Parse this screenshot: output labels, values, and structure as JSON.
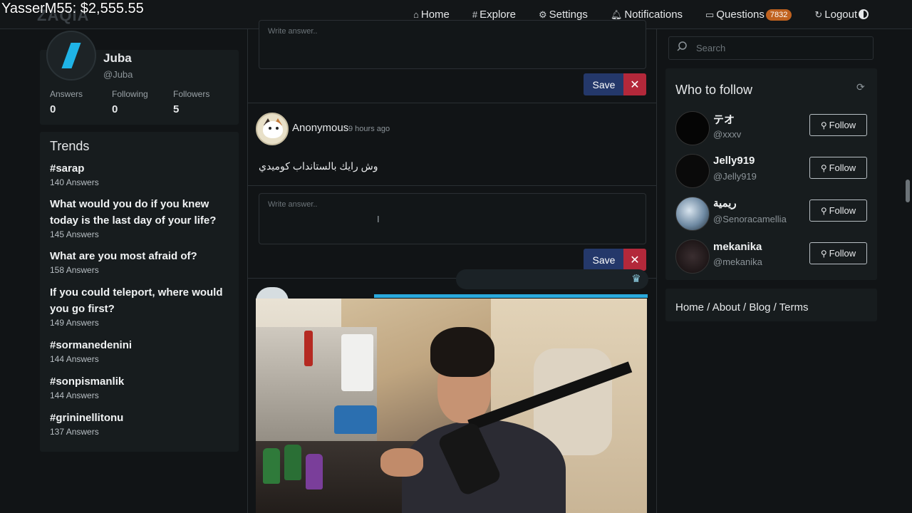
{
  "overlay": {
    "text": "YasserM55: $2,555.55"
  },
  "brand": {
    "logo": "ZAQIA"
  },
  "nav": {
    "home": "Home",
    "explore": "Explore",
    "settings": "Settings",
    "notifications": "Notifications",
    "questions": "Questions",
    "questions_count": "7832",
    "logout": "Logout"
  },
  "profile": {
    "name": "Juba",
    "handle": "@Juba",
    "answers_label": "Answers",
    "answers_value": "0",
    "following_label": "Following",
    "following_value": "0",
    "followers_label": "Followers",
    "followers_value": "5"
  },
  "trends": {
    "title": "Trends",
    "items": [
      {
        "title": "#sarap",
        "count": "140 Answers"
      },
      {
        "title": "What would you do if you knew today is the last day of your life?",
        "count": "145 Answers"
      },
      {
        "title": "What are you most afraid of?",
        "count": "158 Answers"
      },
      {
        "title": "If you could teleport, where would you go first?",
        "count": "149 Answers"
      },
      {
        "title": "#sormanedenini",
        "count": "144 Answers"
      },
      {
        "title": "#sonpismanlik",
        "count": "144 Answers"
      },
      {
        "title": "#grininellitonu",
        "count": "137 Answers"
      }
    ]
  },
  "feed": {
    "answer_placeholder_top": "Write answer..",
    "save_label": "Save",
    "cancel_label": "✕",
    "question": {
      "author": "Anonymous",
      "time": "9 hours ago",
      "text": "وش رايك بالستانداب كوميدي"
    },
    "answer_placeholder": "Write answer.."
  },
  "sidebar": {
    "search_placeholder": "Search",
    "who_to_follow_title": "Who to follow",
    "follow_label": "Follow",
    "users": [
      {
        "name": "テオ",
        "handle": "@xxxv"
      },
      {
        "name": "Jelly919",
        "handle": "@Jelly919"
      },
      {
        "name": "ريمية",
        "handle": "@Senoracamellia"
      },
      {
        "name": "mekanika",
        "handle": "@mekanika"
      }
    ],
    "footer": "Home / About / Blog / Terms"
  },
  "colors": {
    "background": "#111416",
    "card": "#171c1e",
    "save": "#24386a",
    "cancel": "#b3283a",
    "badge": "#c0621f",
    "accent": "#2aa9dc"
  }
}
